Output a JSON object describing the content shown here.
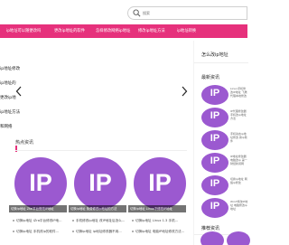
{
  "search": {
    "placeholder": "搜索"
  },
  "nav": {
    "items": [
      "ip地址可以随便改吗",
      "更改ip地址的软件",
      "怎样修改网络ip地址",
      "修改ip地址方法",
      "ip地址转换"
    ]
  },
  "slider": {
    "lines": [
      "ip地址修改",
      "ip地址的",
      "更改ip地",
      "ip地址方法",
      "和网络"
    ]
  },
  "hot": {
    "title": "热点资讯",
    "cards": [
      {
        "badge": "IP",
        "caption": "切换ip地址 Zfai平台修改IP地址"
      },
      {
        "badge": "IP",
        "caption": "切换ip地址 免费修改ip地址的方法"
      },
      {
        "badge": "IP",
        "caption": "切换ip地址 Linux下修改IP地址"
      }
    ],
    "news": [
      [
        "切换ip地址 iZra平台修改IP地...",
        "切换ip地址 手机改ip的软件..."
      ],
      [
        "手机修改ip地址 改IP地址后怎么...",
        "切换ip地址 ip地址修改器不用..."
      ],
      [
        "切换ip地址 Linux 1.3 手机...",
        "切换ip地址 电脑IP地址修改方法..."
      ]
    ]
  },
  "sidebar": {
    "about_title": "怎么改ip地址",
    "latest_title": "最新资讯",
    "latest": [
      {
        "badge": "IP",
        "text": "Linux手机修改IP地址 飞鹰代理本地修改"
      },
      {
        "badge": "IP",
        "text": "IP代理修改器 手机改ip地址方法"
      },
      {
        "badge": "IP",
        "text": "手机动态ip地址修改 换ip软件"
      },
      {
        "badge": "IP",
        "text": "IP地址修改器 电脑改ip 第一财经新闻网"
      },
      {
        "badge": "IP",
        "text": "切换ip地址 网络ip修改"
      },
      {
        "badge": "IP",
        "text": "Win7修改IP地址 电脑修改ip地址"
      }
    ],
    "recommend_title": "推荐资讯"
  },
  "colors": {
    "brand": "#e6317c",
    "badge": "#9b59d0"
  }
}
